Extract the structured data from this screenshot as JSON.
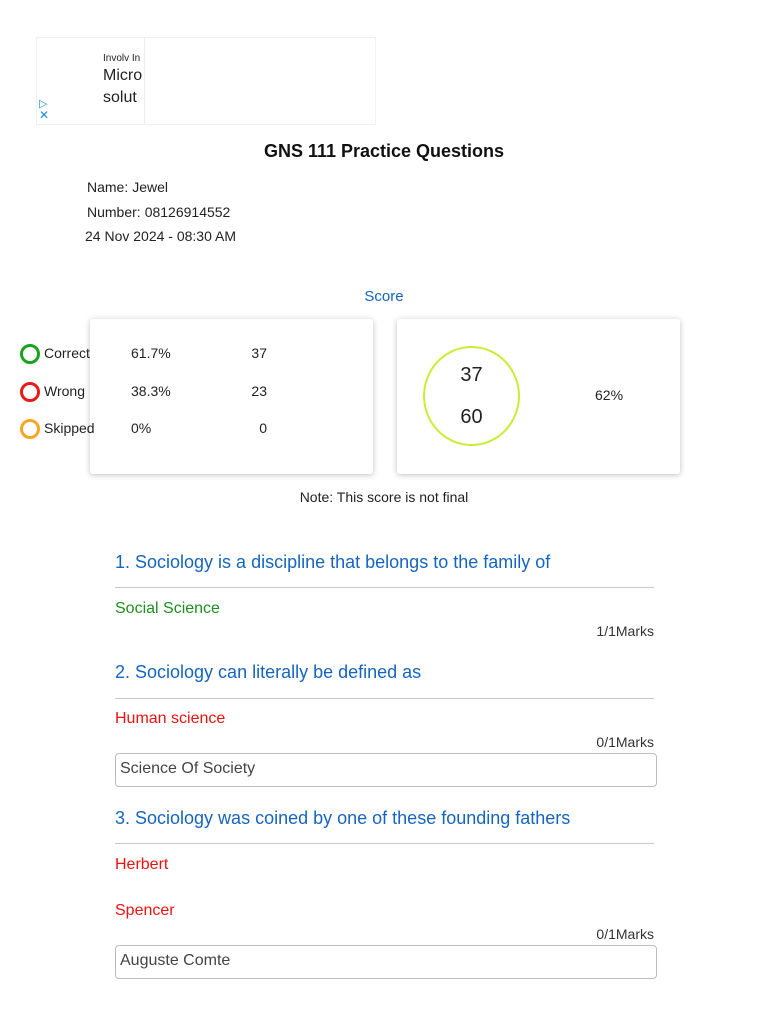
{
  "ad": {
    "small_text": "Involv In",
    "line1": "Micro",
    "line2": "solut",
    "play_icon": "▷",
    "close_icon": "✕"
  },
  "page_title": "GNS 111 Practice Questions",
  "meta": {
    "name_label": "Name:",
    "name_value": "Jewel",
    "number_label": "Number:",
    "number_value": "08126914552",
    "date": "24 Nov 2024 - 08:30 AM"
  },
  "score_label": "Score",
  "stats": [
    {
      "label": "Correct",
      "percent": "61.7%",
      "count": "37",
      "color": "#1aa31a"
    },
    {
      "label": "Wrong",
      "percent": "38.3%",
      "count": "23",
      "color": "#e51c1c"
    },
    {
      "label": "Skipped",
      "percent": "0%",
      "count": "0",
      "color": "#f5a623"
    }
  ],
  "summary": {
    "score": "37",
    "total": "60",
    "percent": "62%",
    "ring_color": "#c6ef34"
  },
  "note": "Note: This score is not final",
  "questions": [
    {
      "text": "1. Sociology is a discipline that belongs to the family of",
      "answers": [
        {
          "text": "Social Science",
          "status": "correct"
        }
      ],
      "marks": "1/1Marks",
      "correct_answer": ""
    },
    {
      "text": "2. Sociology can literally be defined as",
      "answers": [
        {
          "text": "Human science",
          "status": "wrong"
        }
      ],
      "marks": "0/1Marks",
      "correct_answer": "Science Of Society"
    },
    {
      "text": "3. Sociology was coined by one of these founding fathers",
      "answers": [
        {
          "text": "Herbert",
          "status": "wrong"
        },
        {
          "text": "Spencer",
          "status": "wrong"
        }
      ],
      "marks": "0/1Marks",
      "correct_answer": "Auguste Comte"
    }
  ]
}
